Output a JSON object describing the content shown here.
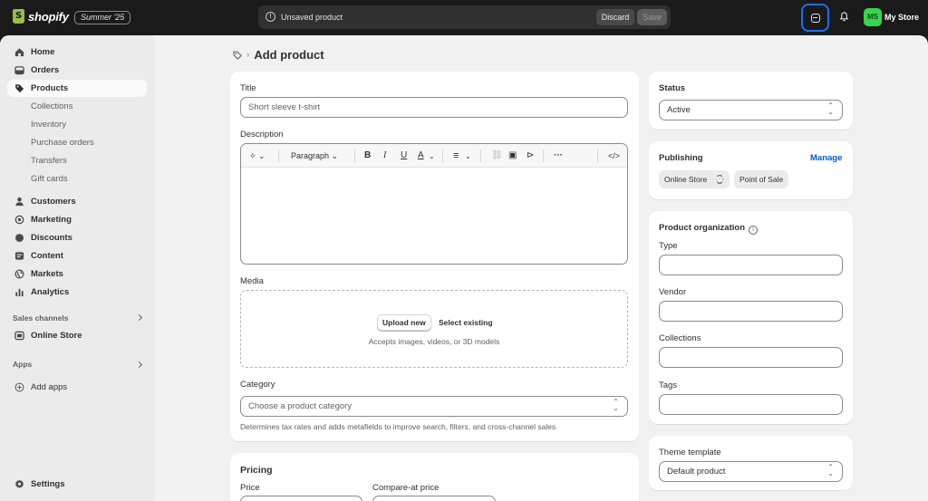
{
  "topbar": {
    "logo_text": "shopify",
    "edition": "Summer '25",
    "unsaved_text": "Unsaved product",
    "discard_label": "Discard",
    "save_label": "Save",
    "avatar_initials": "MS",
    "store_name": "My Store"
  },
  "sidebar": {
    "items": [
      {
        "label": "Home",
        "icon": "home-icon"
      },
      {
        "label": "Orders",
        "icon": "orders-icon"
      },
      {
        "label": "Products",
        "icon": "tag-icon"
      }
    ],
    "product_subitems": [
      "Collections",
      "Inventory",
      "Purchase orders",
      "Transfers",
      "Gift cards"
    ],
    "items2": [
      {
        "label": "Customers",
        "icon": "person-icon"
      },
      {
        "label": "Marketing",
        "icon": "target-icon"
      },
      {
        "label": "Discounts",
        "icon": "discount-icon"
      },
      {
        "label": "Content",
        "icon": "content-icon"
      },
      {
        "label": "Markets",
        "icon": "globe-icon"
      },
      {
        "label": "Analytics",
        "icon": "chart-icon"
      }
    ],
    "sales_channels_label": "Sales channels",
    "online_store_label": "Online Store",
    "apps_label": "Apps",
    "add_apps_label": "Add apps",
    "settings_label": "Settings"
  },
  "page": {
    "title": "Add product"
  },
  "main_card": {
    "title_label": "Title",
    "title_placeholder": "Short sleeve t-shirt",
    "description_label": "Description",
    "paragraph_label": "Paragraph",
    "media_label": "Media",
    "upload_new": "Upload new",
    "select_existing": "Select existing",
    "media_hint": "Accepts images, videos, or 3D models",
    "category_label": "Category",
    "category_placeholder": "Choose a product category",
    "category_help": "Determines tax rates and adds metafields to improve search, filters, and cross-channel sales"
  },
  "pricing": {
    "heading": "Pricing",
    "price_label": "Price",
    "compare_label": "Compare-at price"
  },
  "status": {
    "heading": "Status",
    "value": "Active"
  },
  "publishing": {
    "heading": "Publishing",
    "manage": "Manage",
    "channels": [
      "Online Store",
      "Point of Sale"
    ]
  },
  "organization": {
    "heading": "Product organization",
    "type_label": "Type",
    "vendor_label": "Vendor",
    "collections_label": "Collections",
    "tags_label": "Tags"
  },
  "theme": {
    "heading": "Theme template",
    "value": "Default product"
  },
  "colors": {
    "topbar_bg": "#1a1a1a",
    "accent_blue": "#005bd3",
    "avatar_green": "#36d74b",
    "page_bg": "#f1f1f1"
  }
}
